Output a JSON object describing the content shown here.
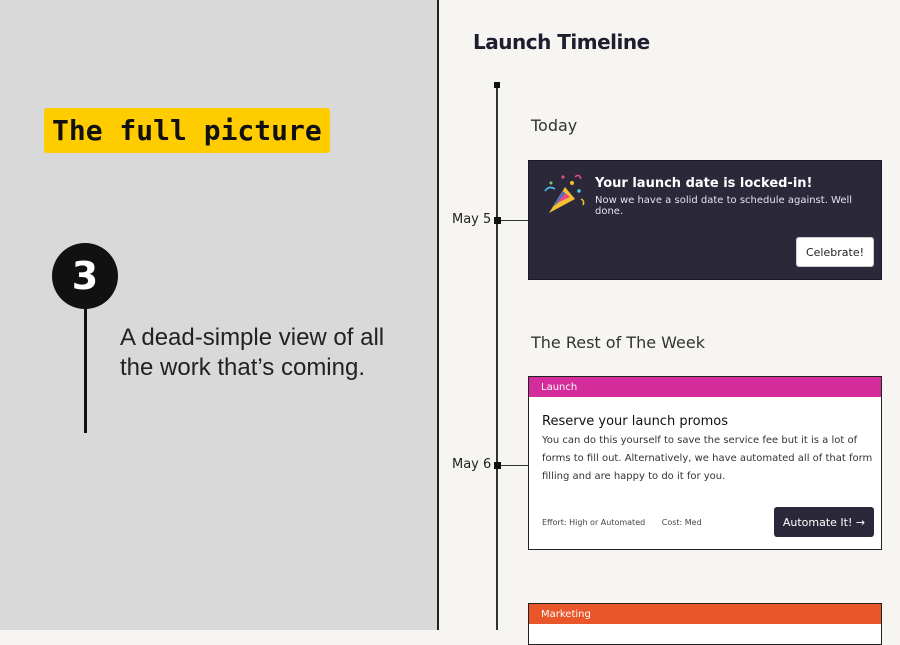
{
  "left_panel": {
    "tagline": "The full picture",
    "step_number": "3",
    "step_text": "A dead-simple view of all the work that’s coming."
  },
  "timeline": {
    "title": "Launch Timeline",
    "sections": [
      {
        "heading": "Today"
      },
      {
        "heading": "The Rest of The Week"
      }
    ],
    "markers": [
      {
        "date": "May 5"
      },
      {
        "date": "May 6"
      }
    ],
    "today_card": {
      "icon": "party-popper-icon",
      "title": "Your launch date is locked-in!",
      "description": "Now we have a solid date to schedule against. Well done.",
      "button_label": "Celebrate!"
    },
    "tasks": [
      {
        "tag": "Launch",
        "tag_color": "#d42d9b",
        "title": "Reserve your launch promos",
        "description": "You can do this yourself to save the service fee but it is a lot of forms to fill out. Alternatively, we have automated all of that form filling and are happy to do it for you.",
        "effort": "Effort: High or Automated",
        "cost": "Cost: Med",
        "button_label": "Automate It! →"
      },
      {
        "tag": "Marketing",
        "tag_color": "#e8562a"
      }
    ]
  },
  "colors": {
    "highlight": "#ffcc00",
    "dark_card": "#2b2839",
    "left_bg": "#d9d9d9",
    "right_bg": "#f7f5f2"
  }
}
